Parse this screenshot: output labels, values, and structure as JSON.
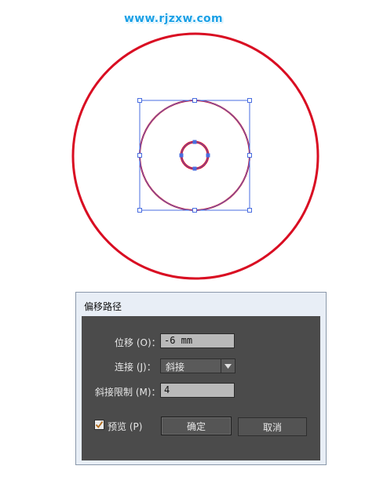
{
  "watermark": "www.rjzxw.com",
  "colors": {
    "circle_stroke": "#d90d22",
    "selection": "#4a6ee0",
    "dialog_bg": "#4b4b4b"
  },
  "canvas": {
    "shapes": [
      "outer-circle",
      "middle-circle",
      "inner-circle"
    ],
    "selection": "bounding-box"
  },
  "dialog": {
    "title": "偏移路径",
    "offset": {
      "label": "位移 (O)：",
      "value": "-6 mm"
    },
    "joins": {
      "label": "连接 (J)：",
      "selected": "斜接",
      "arrow_icon": "chevron-down-icon"
    },
    "miter_limit": {
      "label": "斜接限制 (M)：",
      "value": "4"
    },
    "preview": {
      "label": "预览 (P)",
      "checked": true
    },
    "ok_label": "确定",
    "cancel_label": "取消"
  }
}
